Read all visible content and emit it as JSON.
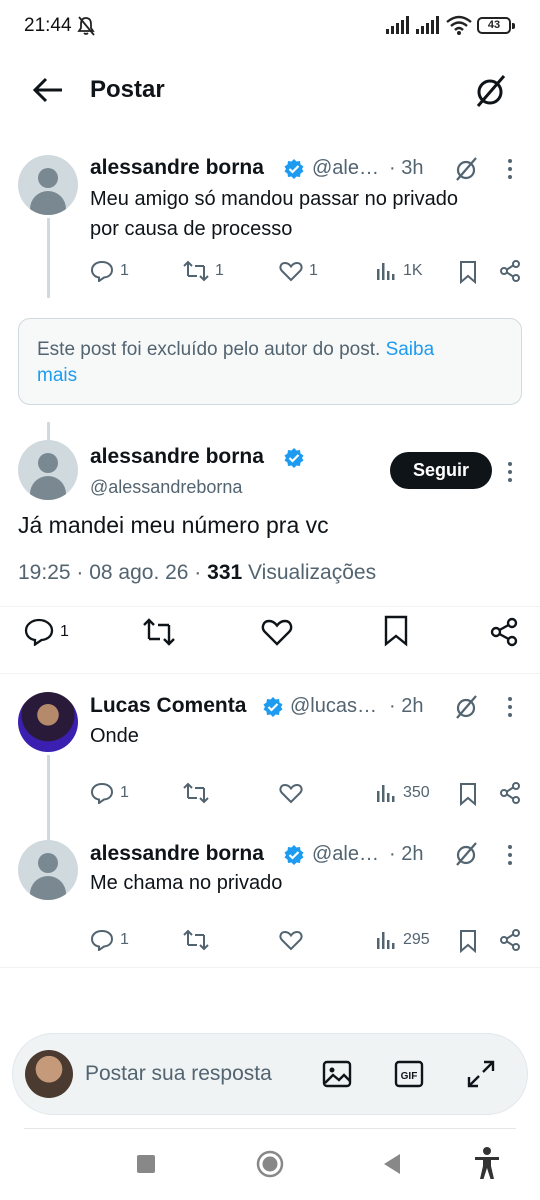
{
  "status_bar": {
    "time": "21:44",
    "battery": "43"
  },
  "header": {
    "title": "Postar"
  },
  "tweet1": {
    "name": "alessandre borna",
    "handle": "@ale…",
    "time": "· 3h",
    "text_line1": "Meu amigo só mandou passar no privado",
    "text_line2": "por causa de processo",
    "replies": "1",
    "reposts": "1",
    "likes": "1",
    "views": "1K"
  },
  "deleted": {
    "text": "Este post foi excluído pelo autor do post.",
    "link": "Saiba",
    "link2": "mais"
  },
  "main_tweet": {
    "name": "alessandre borna",
    "handle": "@alessandreborna",
    "follow_label": "Seguir",
    "text": "Já mandei meu número pra vc",
    "date": "19:25 · 08 ago. 26 ·",
    "views_count": "331",
    "views_label": "Visualizações",
    "replies": "1"
  },
  "reply1": {
    "name": "Lucas Comenta",
    "handle": "@lucas…",
    "time": "· 2h",
    "text": "Onde",
    "replies": "1",
    "views": "350"
  },
  "reply2": {
    "name": "alessandre borna",
    "handle": "@ale…",
    "time": "· 2h",
    "text": "Me chama no privado",
    "replies": "1",
    "views": "295"
  },
  "reply_bar": {
    "placeholder": "Postar sua resposta"
  },
  "colors": {
    "accent": "#1d9bf0",
    "text": "#0f1419",
    "muted": "#536471"
  }
}
